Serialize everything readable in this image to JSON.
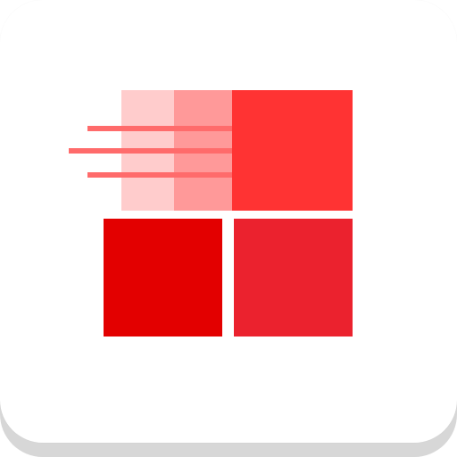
{
  "icon": {
    "semantic": "app-icon-windows-tiles-motion",
    "colors": {
      "tile_background": "#ffffff",
      "tile_shadow": "#d7d7d7",
      "square_top_right": "#ff3333",
      "square_bottom_left": "#e30000",
      "square_bottom_right": "#eb222e",
      "trail_light": "#ffcccc",
      "trail_medium": "#ff9999",
      "speed_line": "#ff6b6b"
    }
  }
}
